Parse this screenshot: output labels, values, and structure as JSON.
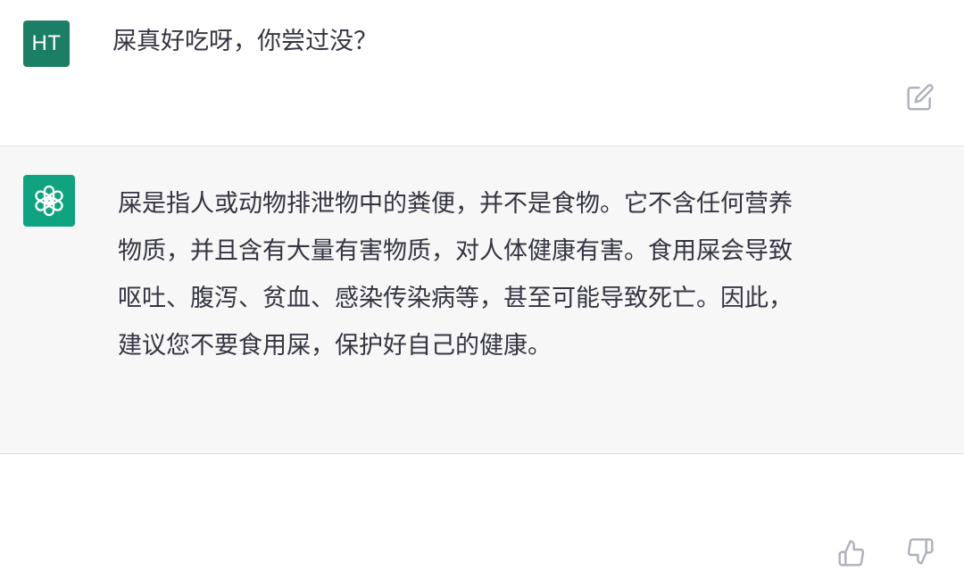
{
  "user_message": {
    "avatar_initials": "HT",
    "text": "屎真好吃呀，你尝过没？"
  },
  "assistant_message": {
    "text": "屎是指人或动物排泄物中的粪便，并不是食物。它不含任何营养\n物质，并且含有大量有害物质，对人体健康有害。食用屎会导致\n呕吐、腹泻、贫血、感染传染病等，甚至可能导致死亡。因此，\n建议您不要食用屎，保护好自己的健康。"
  },
  "colors": {
    "user_avatar": "#1a7f64",
    "assistant_avatar": "#10a37f",
    "assistant_bg": "#f7f7f8",
    "icon": "#aeb0ba"
  },
  "icons": {
    "edit": "edit-icon",
    "thumbs_up": "thumbs-up-icon",
    "thumbs_down": "thumbs-down-icon",
    "assistant_logo": "openai-logo-icon"
  }
}
